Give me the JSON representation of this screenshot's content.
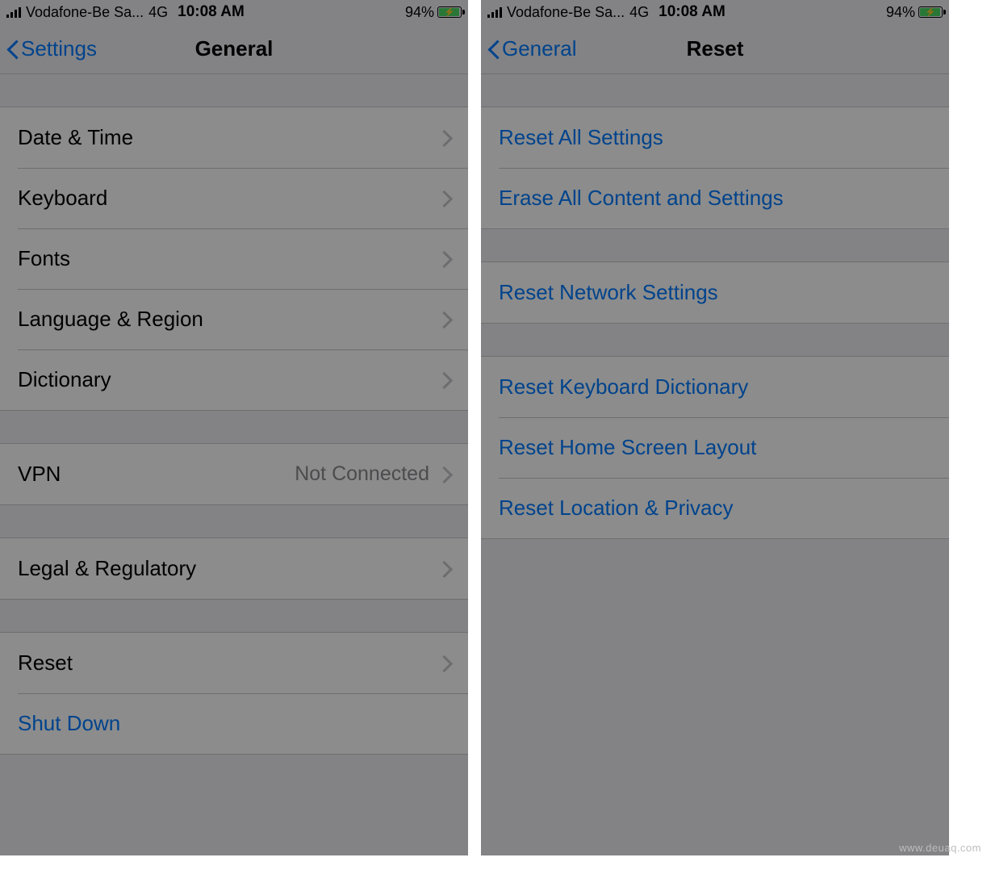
{
  "status": {
    "carrier": "Vodafone-Be Sa...",
    "network": "4G",
    "time": "10:08 AM",
    "battery_pct": "94%"
  },
  "left": {
    "back_label": "Settings",
    "title": "General",
    "groups": [
      {
        "rows": [
          {
            "name": "date-time",
            "label": "Date & Time"
          },
          {
            "name": "keyboard",
            "label": "Keyboard"
          },
          {
            "name": "fonts",
            "label": "Fonts"
          },
          {
            "name": "language-region",
            "label": "Language & Region"
          },
          {
            "name": "dictionary",
            "label": "Dictionary"
          }
        ]
      },
      {
        "rows": [
          {
            "name": "vpn",
            "label": "VPN",
            "value": "Not Connected"
          }
        ]
      },
      {
        "rows": [
          {
            "name": "legal-regulatory",
            "label": "Legal & Regulatory"
          }
        ]
      },
      {
        "rows": [
          {
            "name": "reset",
            "label": "Reset",
            "highlight": true
          },
          {
            "name": "shut-down",
            "label": "Shut Down",
            "action": true,
            "no_chevron": true
          }
        ]
      }
    ]
  },
  "right": {
    "back_label": "General",
    "title": "Reset",
    "groups": [
      {
        "rows": [
          {
            "name": "reset-all-settings",
            "label": "Reset All Settings",
            "action": true,
            "no_chevron": true
          },
          {
            "name": "erase-all",
            "label": "Erase All Content and Settings",
            "action": true,
            "no_chevron": true,
            "highlight": true
          }
        ]
      },
      {
        "rows": [
          {
            "name": "reset-network",
            "label": "Reset Network Settings",
            "action": true,
            "no_chevron": true
          }
        ]
      },
      {
        "rows": [
          {
            "name": "reset-keyboard-dict",
            "label": "Reset Keyboard Dictionary",
            "action": true,
            "no_chevron": true
          },
          {
            "name": "reset-home-layout",
            "label": "Reset Home Screen Layout",
            "action": true,
            "no_chevron": true
          },
          {
            "name": "reset-location-privacy",
            "label": "Reset Location & Privacy",
            "action": true,
            "no_chevron": true
          }
        ]
      }
    ]
  },
  "watermark": "www.deuaq.com"
}
